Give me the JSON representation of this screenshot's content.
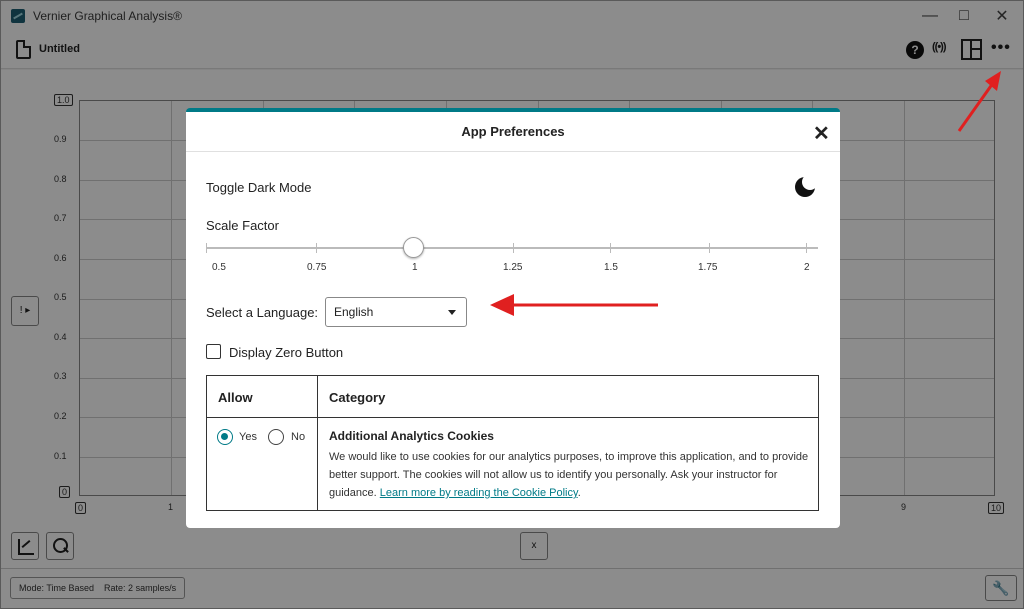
{
  "window": {
    "title": "Vernier Graphical Analysis®"
  },
  "toolbar": {
    "document_title": "Untitled",
    "help_label": "?",
    "sensor_label": "((•))",
    "more_label": "•••"
  },
  "graph": {
    "y_ticks": [
      "1.0",
      "0.9",
      "0.8",
      "0.7",
      "0.6",
      "0.5",
      "0.4",
      "0.3",
      "0.2",
      "0.1",
      "0"
    ],
    "x_ticks": [
      "0",
      "1",
      "9",
      "10"
    ],
    "y_axis_button": "! ▸",
    "x_axis_button": "x"
  },
  "footer": {
    "mode": "Mode: Time Based",
    "rate": "Rate: 2 samples/s",
    "settings_icon": "🔧"
  },
  "dialog": {
    "title": "App Preferences",
    "close_label": "✕",
    "dark_mode_label": "Toggle Dark Mode",
    "scale_label": "Scale Factor",
    "scale_ticks": [
      "0.5",
      "0.75",
      "1",
      "1.25",
      "1.5",
      "1.75",
      "2"
    ],
    "scale_value": 1,
    "language_label": "Select a Language:",
    "language_value": "English",
    "zero_button_label": "Display Zero Button",
    "zero_button_checked": false,
    "table": {
      "header_allow": "Allow",
      "header_category": "Category",
      "yes_label": "Yes",
      "no_label": "No",
      "selected": "Yes",
      "cookie_title": "Additional Analytics Cookies",
      "cookie_description": "We would like to use cookies for our analytics purposes, to improve this application, and to provide better support. The cookies will not allow us to identify you personally. Ask your instructor for guidance.",
      "cookie_link": "Learn more by reading the Cookie Policy"
    }
  },
  "colors": {
    "accent": "#007a87",
    "annotation_arrow": "#e02020"
  }
}
